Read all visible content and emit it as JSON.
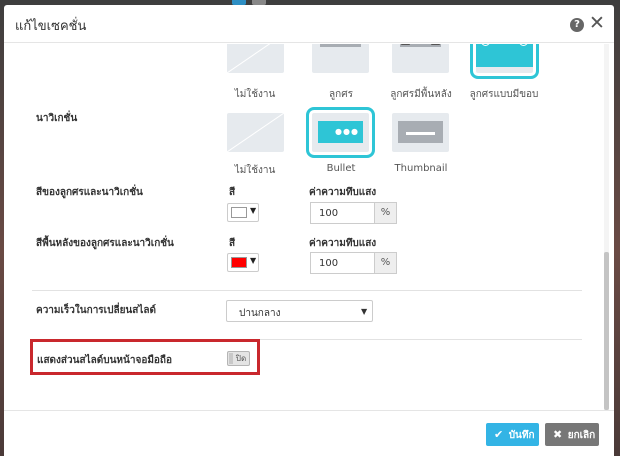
{
  "dialog": {
    "title": "แก้ไขเซคชั่น",
    "help_icon": "question-circle-icon",
    "help_glyph": "?",
    "close_icon": "close-icon",
    "close_glyph": "✕"
  },
  "arrow_styles": {
    "options": [
      {
        "label": "ไม่ใช้งาน",
        "style": "none",
        "selected": false
      },
      {
        "label": "ลูกศร",
        "style": "arrow",
        "selected": false
      },
      {
        "label": "ลูกศรมีพื้นหลัง",
        "style": "arrow-bg",
        "selected": false
      },
      {
        "label": "ลูกศรแบบมีขอบ",
        "style": "arrow-border",
        "selected": true
      }
    ]
  },
  "navigation": {
    "label": "นาวิเกชั่น",
    "options": [
      {
        "label": "ไม่ใช้งาน",
        "selected": false
      },
      {
        "label": "Bullet",
        "selected": true
      },
      {
        "label": "Thumbnail",
        "selected": false
      }
    ]
  },
  "arrow_nav_color": {
    "label": "สีของลูกศรและนาวิเกชั่น",
    "color_label": "สี",
    "color_value": "#ffffff",
    "opacity_label": "ค่าความทึบแสง",
    "opacity_value": "100",
    "opacity_unit": "%"
  },
  "arrow_nav_bg_color": {
    "label": "สีพื้นหลังของลูกศรและนาวิเกชั่น",
    "color_label": "สี",
    "color_value": "#ff0000",
    "opacity_label": "ค่าความทึบแสง",
    "opacity_value": "100",
    "opacity_unit": "%"
  },
  "transition_speed": {
    "label": "ความเร็วในการเปลี่ยนสไลด์",
    "selected": "ปานกลาง"
  },
  "mobile_display": {
    "label": "แสดงส่วนสไลด์บนหน้าจอมือถือ",
    "toggle_text": "ปิด",
    "highlight_color": "#c9282d"
  },
  "footer": {
    "save_label": "บันทึก",
    "save_icon": "check-icon",
    "save_glyph": "✔",
    "cancel_label": "ยกเลิก",
    "cancel_icon": "x-icon",
    "cancel_glyph": "✖"
  },
  "colors": {
    "accent": "#2ec5d6",
    "primary_button": "#33b4e5",
    "secondary_button": "#777777"
  }
}
